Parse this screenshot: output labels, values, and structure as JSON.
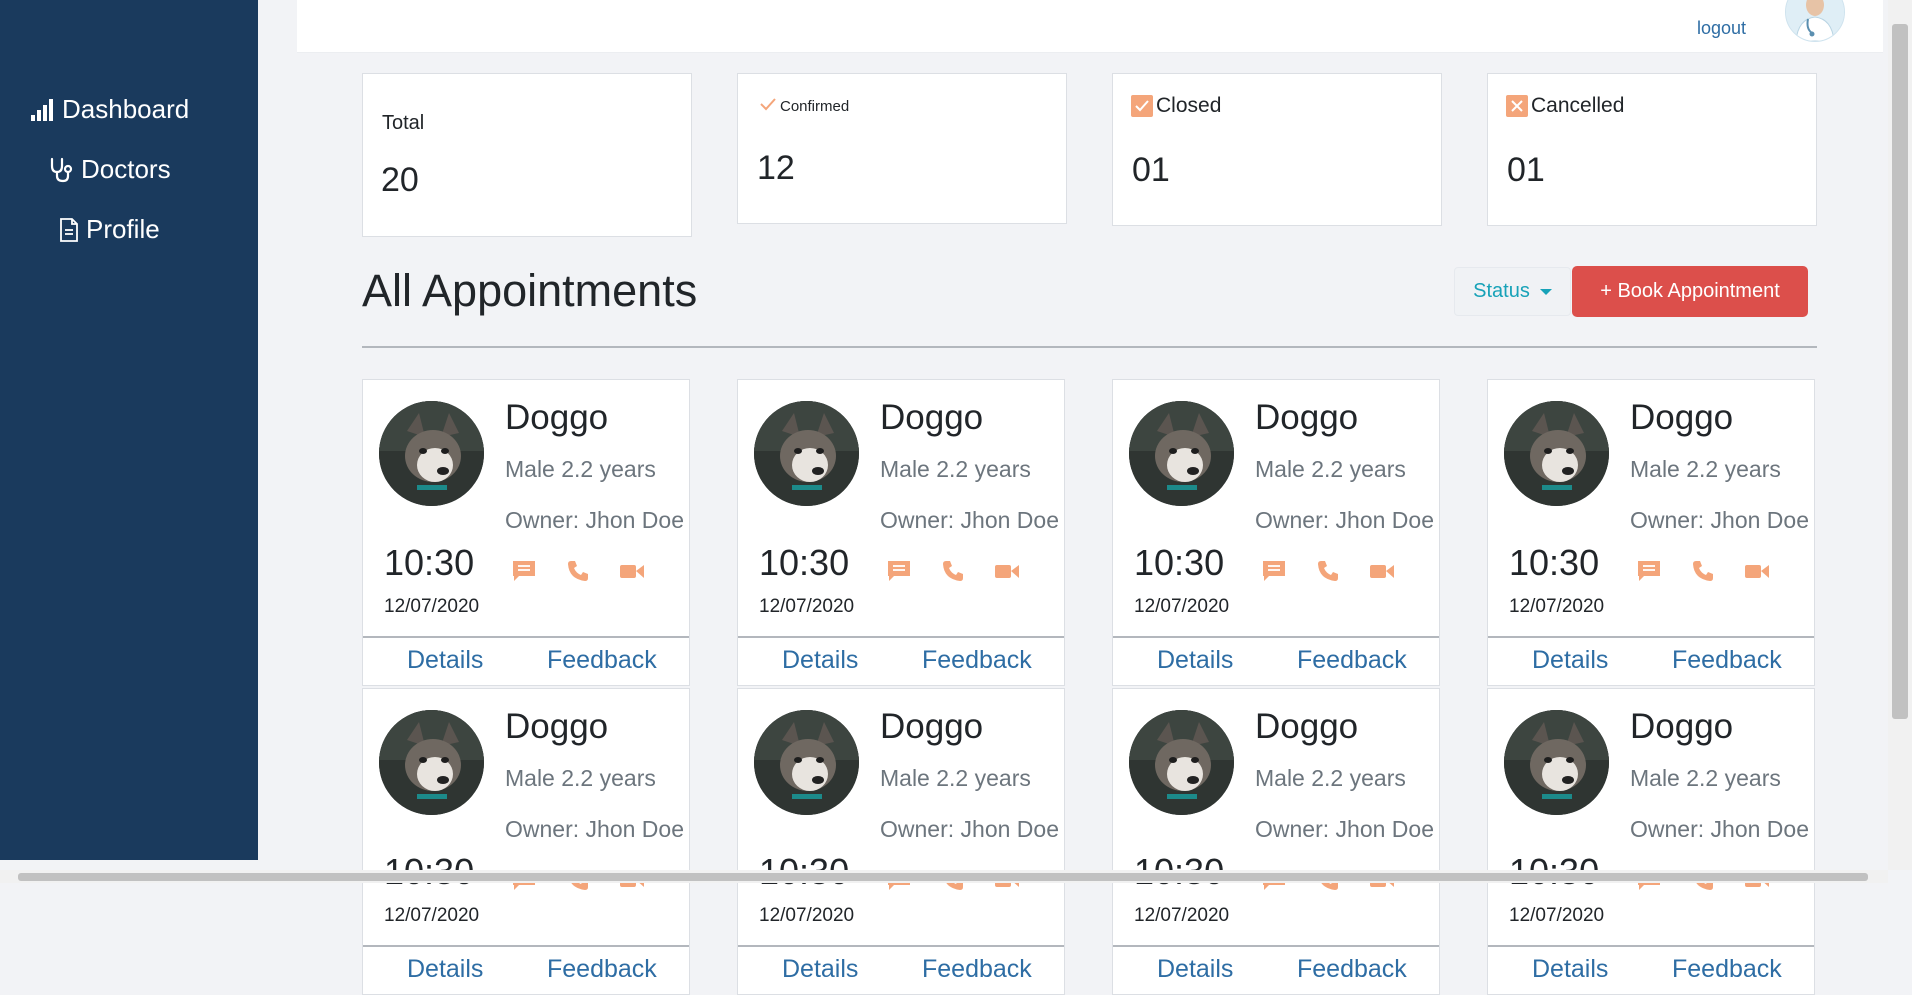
{
  "sidebar": {
    "items": [
      {
        "label": "Dashboard",
        "icon": "bar-chart-icon"
      },
      {
        "label": "Doctors",
        "icon": "stethoscope-icon"
      },
      {
        "label": "Profile",
        "icon": "document-icon"
      }
    ]
  },
  "header": {
    "logout_label": "logout",
    "avatar_icon": "doctor-avatar"
  },
  "stats": [
    {
      "label": "Total",
      "value": "20"
    },
    {
      "label": "Confirmed",
      "value": "12",
      "icon": "check-icon"
    },
    {
      "label": "Closed",
      "value": "01",
      "icon": "check-badge-icon"
    },
    {
      "label": "Cancelled",
      "value": "01",
      "icon": "x-badge-icon"
    }
  ],
  "main": {
    "title": "All Appointments",
    "status_label": "Status",
    "book_label": "+ Book Appointment"
  },
  "appointments": [
    {
      "name": "Doggo",
      "info": "Male 2.2 years",
      "owner": "Owner: Jhon Doe",
      "time": "10:30",
      "date": "12/07/2020",
      "details": "Details",
      "feedback": "Feedback"
    },
    {
      "name": "Doggo",
      "info": "Male 2.2 years",
      "owner": "Owner: Jhon Doe",
      "time": "10:30",
      "date": "12/07/2020",
      "details": "Details",
      "feedback": "Feedback"
    },
    {
      "name": "Doggo",
      "info": "Male 2.2 years",
      "owner": "Owner: Jhon Doe",
      "time": "10:30",
      "date": "12/07/2020",
      "details": "Details",
      "feedback": "Feedback"
    },
    {
      "name": "Doggo",
      "info": "Male 2.2 years",
      "owner": "Owner: Jhon Doe",
      "time": "10:30",
      "date": "12/07/2020",
      "details": "Details",
      "feedback": "Feedback"
    },
    {
      "name": "Doggo",
      "info": "Male 2.2 years",
      "owner": "Owner: Jhon Doe",
      "time": "10:30",
      "date": "12/07/2020",
      "details": "Details",
      "feedback": "Feedback"
    },
    {
      "name": "Doggo",
      "info": "Male 2.2 years",
      "owner": "Owner: Jhon Doe",
      "time": "10:30",
      "date": "12/07/2020",
      "details": "Details",
      "feedback": "Feedback"
    },
    {
      "name": "Doggo",
      "info": "Male 2.2 years",
      "owner": "Owner: Jhon Doe",
      "time": "10:30",
      "date": "12/07/2020",
      "details": "Details",
      "feedback": "Feedback"
    },
    {
      "name": "Doggo",
      "info": "Male 2.2 years",
      "owner": "Owner: Jhon Doe",
      "time": "10:30",
      "date": "12/07/2020",
      "details": "Details",
      "feedback": "Feedback"
    }
  ],
  "colors": {
    "sidebar": "#1a3a5d",
    "accent_orange": "#f4a57a",
    "link_blue": "#2e6da4",
    "book_red": "#dc4f4b",
    "status_teal": "#17a2b8"
  }
}
